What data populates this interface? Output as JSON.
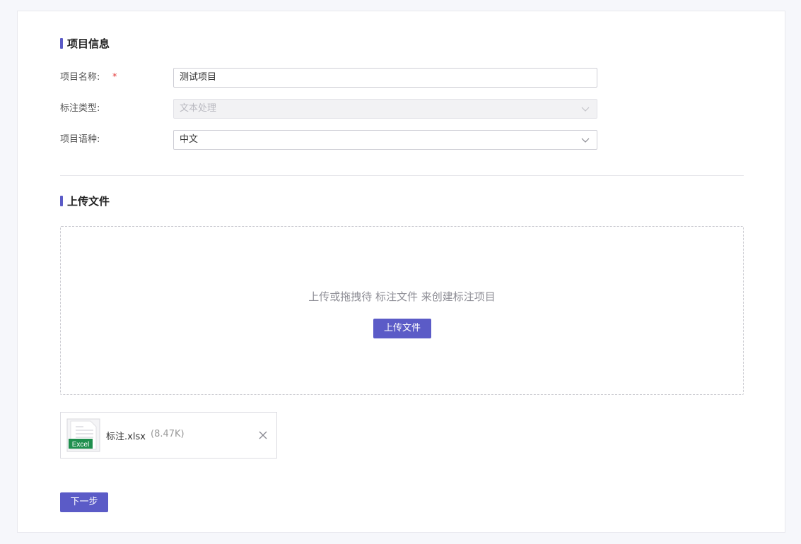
{
  "project_info": {
    "section_title": "项目信息",
    "fields": [
      {
        "label": "项目名称:",
        "required_mark": "*",
        "value": "测试项目"
      },
      {
        "label": "标注类型:",
        "value": "文本处理"
      },
      {
        "label": "项目语种:",
        "value": "中文"
      }
    ]
  },
  "upload": {
    "section_title": "上传文件",
    "hint": "上传或拖拽待 标注文件 来创建标注项目",
    "button_label": "上传文件"
  },
  "file": {
    "badge": "Excel",
    "name": "标注.xlsx",
    "size": "(8.47K)"
  },
  "footer": {
    "next_label": "下一步"
  },
  "colors": {
    "accent": "#5b5bc7",
    "required": "#e23b3b",
    "excel_green": "#1f8f4e"
  }
}
